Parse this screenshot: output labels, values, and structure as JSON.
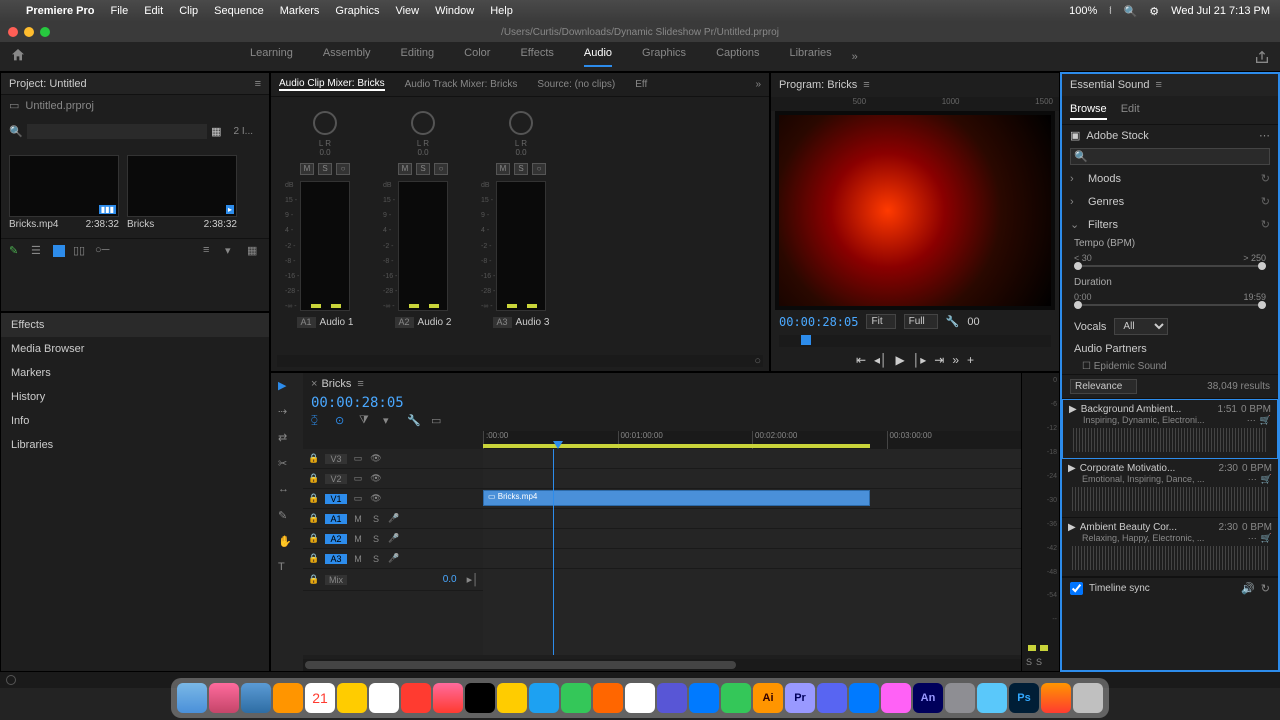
{
  "menubar": {
    "app": "Premiere Pro",
    "items": [
      "File",
      "Edit",
      "Clip",
      "Sequence",
      "Markers",
      "Graphics",
      "View",
      "Window",
      "Help"
    ],
    "battery": "100%",
    "datetime": "Wed Jul 21  7:13 PM"
  },
  "titlebar": {
    "path": "/Users/Curtis/Downloads/Dynamic Slideshow Pr/Untitled.prproj"
  },
  "workspaces": {
    "items": [
      "Learning",
      "Assembly",
      "Editing",
      "Color",
      "Effects",
      "Audio",
      "Graphics",
      "Captions",
      "Libraries"
    ],
    "active": "Audio"
  },
  "project": {
    "title": "Project: Untitled",
    "file": "Untitled.prproj",
    "item_count": "2 I...",
    "bins": [
      {
        "name": "Bricks.mp4",
        "duration": "2:38:32",
        "badge": ""
      },
      {
        "name": "Bricks",
        "duration": "2:38:32",
        "badge": ""
      }
    ]
  },
  "shelf": [
    "Effects",
    "Media Browser",
    "Markers",
    "History",
    "Info",
    "Libraries"
  ],
  "mixer": {
    "tabs": [
      "Audio Clip Mixer: Bricks",
      "Audio Track Mixer: Bricks",
      "Source: (no clips)",
      "Eff"
    ],
    "lr": "L    R",
    "zero": "0.0",
    "channels": [
      {
        "id": "A1",
        "name": "Audio 1"
      },
      {
        "id": "A2",
        "name": "Audio 2"
      },
      {
        "id": "A3",
        "name": "Audio 3"
      }
    ],
    "scale": [
      "dB",
      "15 -",
      "9 -",
      "4 -",
      "-2 -",
      "-8 -",
      "-16 -",
      "-28 -",
      "-∞ -"
    ],
    "btns": [
      "M",
      "S",
      "○"
    ]
  },
  "program": {
    "title": "Program: Bricks",
    "ruler": [
      "",
      "500",
      "1000",
      "1500"
    ],
    "timecode": "00:00:28:05",
    "fit": "Fit",
    "full": "Full",
    "out": "00"
  },
  "timeline": {
    "title": "Bricks",
    "timecode": "00:00:28:05",
    "ruler": [
      ":00:00",
      "00:01:00:00",
      "00:02:00:00",
      "00:03:00:00"
    ],
    "video_tracks": [
      {
        "label": "V3",
        "sel": false
      },
      {
        "label": "V2",
        "sel": false
      },
      {
        "label": "V1",
        "sel": true
      }
    ],
    "audio_tracks": [
      {
        "label": "A1",
        "sel": true
      },
      {
        "label": "A2",
        "sel": true
      },
      {
        "label": "A3",
        "sel": true
      }
    ],
    "mix_label": "Mix",
    "mix_val": "0.0",
    "clip_name": "Bricks.mp4",
    "meter_scale": [
      "0",
      "-6",
      "-12",
      "-18",
      "-24",
      "-30",
      "-36",
      "-42",
      "-48",
      "-54",
      "--"
    ],
    "meter_ss": [
      "S",
      "S"
    ]
  },
  "essential_sound": {
    "title": "Essential Sound",
    "tabs": [
      "Browse",
      "Edit"
    ],
    "stock": "Adobe Stock",
    "sections": {
      "moods": "Moods",
      "genres": "Genres",
      "filters": "Filters"
    },
    "tempo_label": "Tempo (BPM)",
    "tempo_min": "< 30",
    "tempo_max": "> 250",
    "duration_label": "Duration",
    "dur_min": "0:00",
    "dur_max": "19:59",
    "vocals_label": "Vocals",
    "vocals_value": "All",
    "partners_label": "Audio Partners",
    "partner_chk": "Epidemic Sound",
    "sort": "Relevance",
    "results": "38,049 results",
    "items": [
      {
        "title": "Background Ambient...",
        "dur": "1:51",
        "bpm": "0 BPM",
        "tags": "Inspiring, Dynamic, Electroni..."
      },
      {
        "title": "Corporate Motivatio...",
        "dur": "2:30",
        "bpm": "0 BPM",
        "tags": "Emotional, Inspiring, Dance, ..."
      },
      {
        "title": "Ambient Beauty Cor...",
        "dur": "2:30",
        "bpm": "0 BPM",
        "tags": "Relaxing, Happy, Electronic, ..."
      }
    ],
    "timeline_sync": "Timeline sync"
  }
}
